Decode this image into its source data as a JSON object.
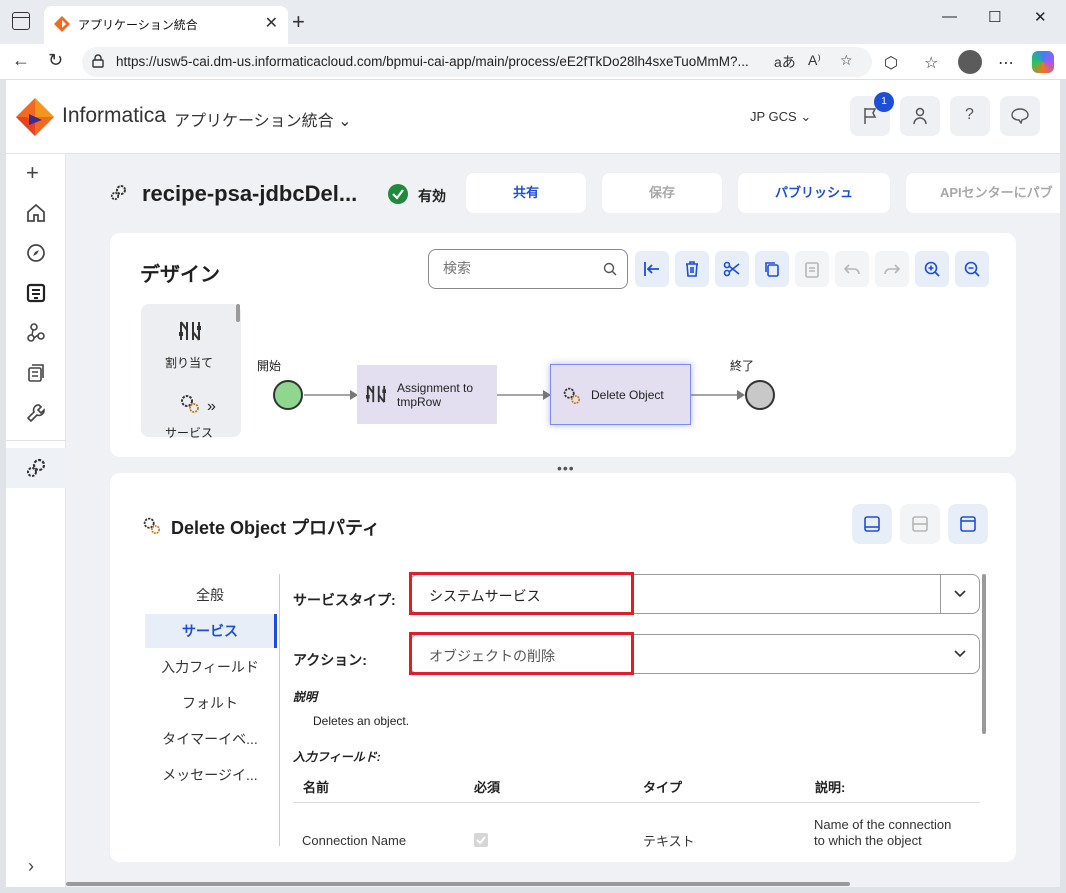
{
  "browser": {
    "tab_title": "アプリケーション統合",
    "url": "https://usw5-cai.dm-us.informaticacloud.com/bpmui-cai-app/main/process/eE2fTkDo28lh4sxeTuoMmM?..."
  },
  "header": {
    "brand": "Informatica",
    "product": "アプリケーション統合",
    "org": "JP GCS",
    "notification_count": "1"
  },
  "page": {
    "title": "recipe-psa-jdbcDel...",
    "status": "有効",
    "actions": {
      "share": "共有",
      "save": "保存",
      "publish": "パブリッシュ",
      "api_center": "APIセンターにパブ"
    }
  },
  "design": {
    "title": "デザイン",
    "search_placeholder": "検索",
    "palette": {
      "assign": "割り当て",
      "service": "サービス"
    },
    "start_label": "開始",
    "end_label": "終了",
    "nodes": {
      "assignment": "Assignment to tmpRow",
      "delete": "Delete Object"
    }
  },
  "properties": {
    "title": "Delete Object プロパティ",
    "tabs": [
      "全般",
      "サービス",
      "入力フィールド",
      "フォルト",
      "タイマーイベ...",
      "メッセージイ..."
    ],
    "service_type_label": "サービスタイプ:",
    "service_type_value": "システムサービス",
    "action_label": "アクション:",
    "action_value": "オブジェクトの削除",
    "description_head": "説明",
    "description_text": "Deletes an object.",
    "input_fields_head": "入力フィールド:",
    "columns": {
      "name": "名前",
      "required": "必須",
      "type": "タイプ",
      "description": "説明:"
    },
    "row": {
      "name": "Connection Name",
      "type": "テキスト",
      "description_line1": "Name of the connection",
      "description_line2": "to which the object"
    }
  },
  "colors": {
    "accent": "#1d4ed8",
    "highlight": "#e11d2c",
    "node_bg": "#e3dff0",
    "status_ok": "#1f8a3c"
  }
}
